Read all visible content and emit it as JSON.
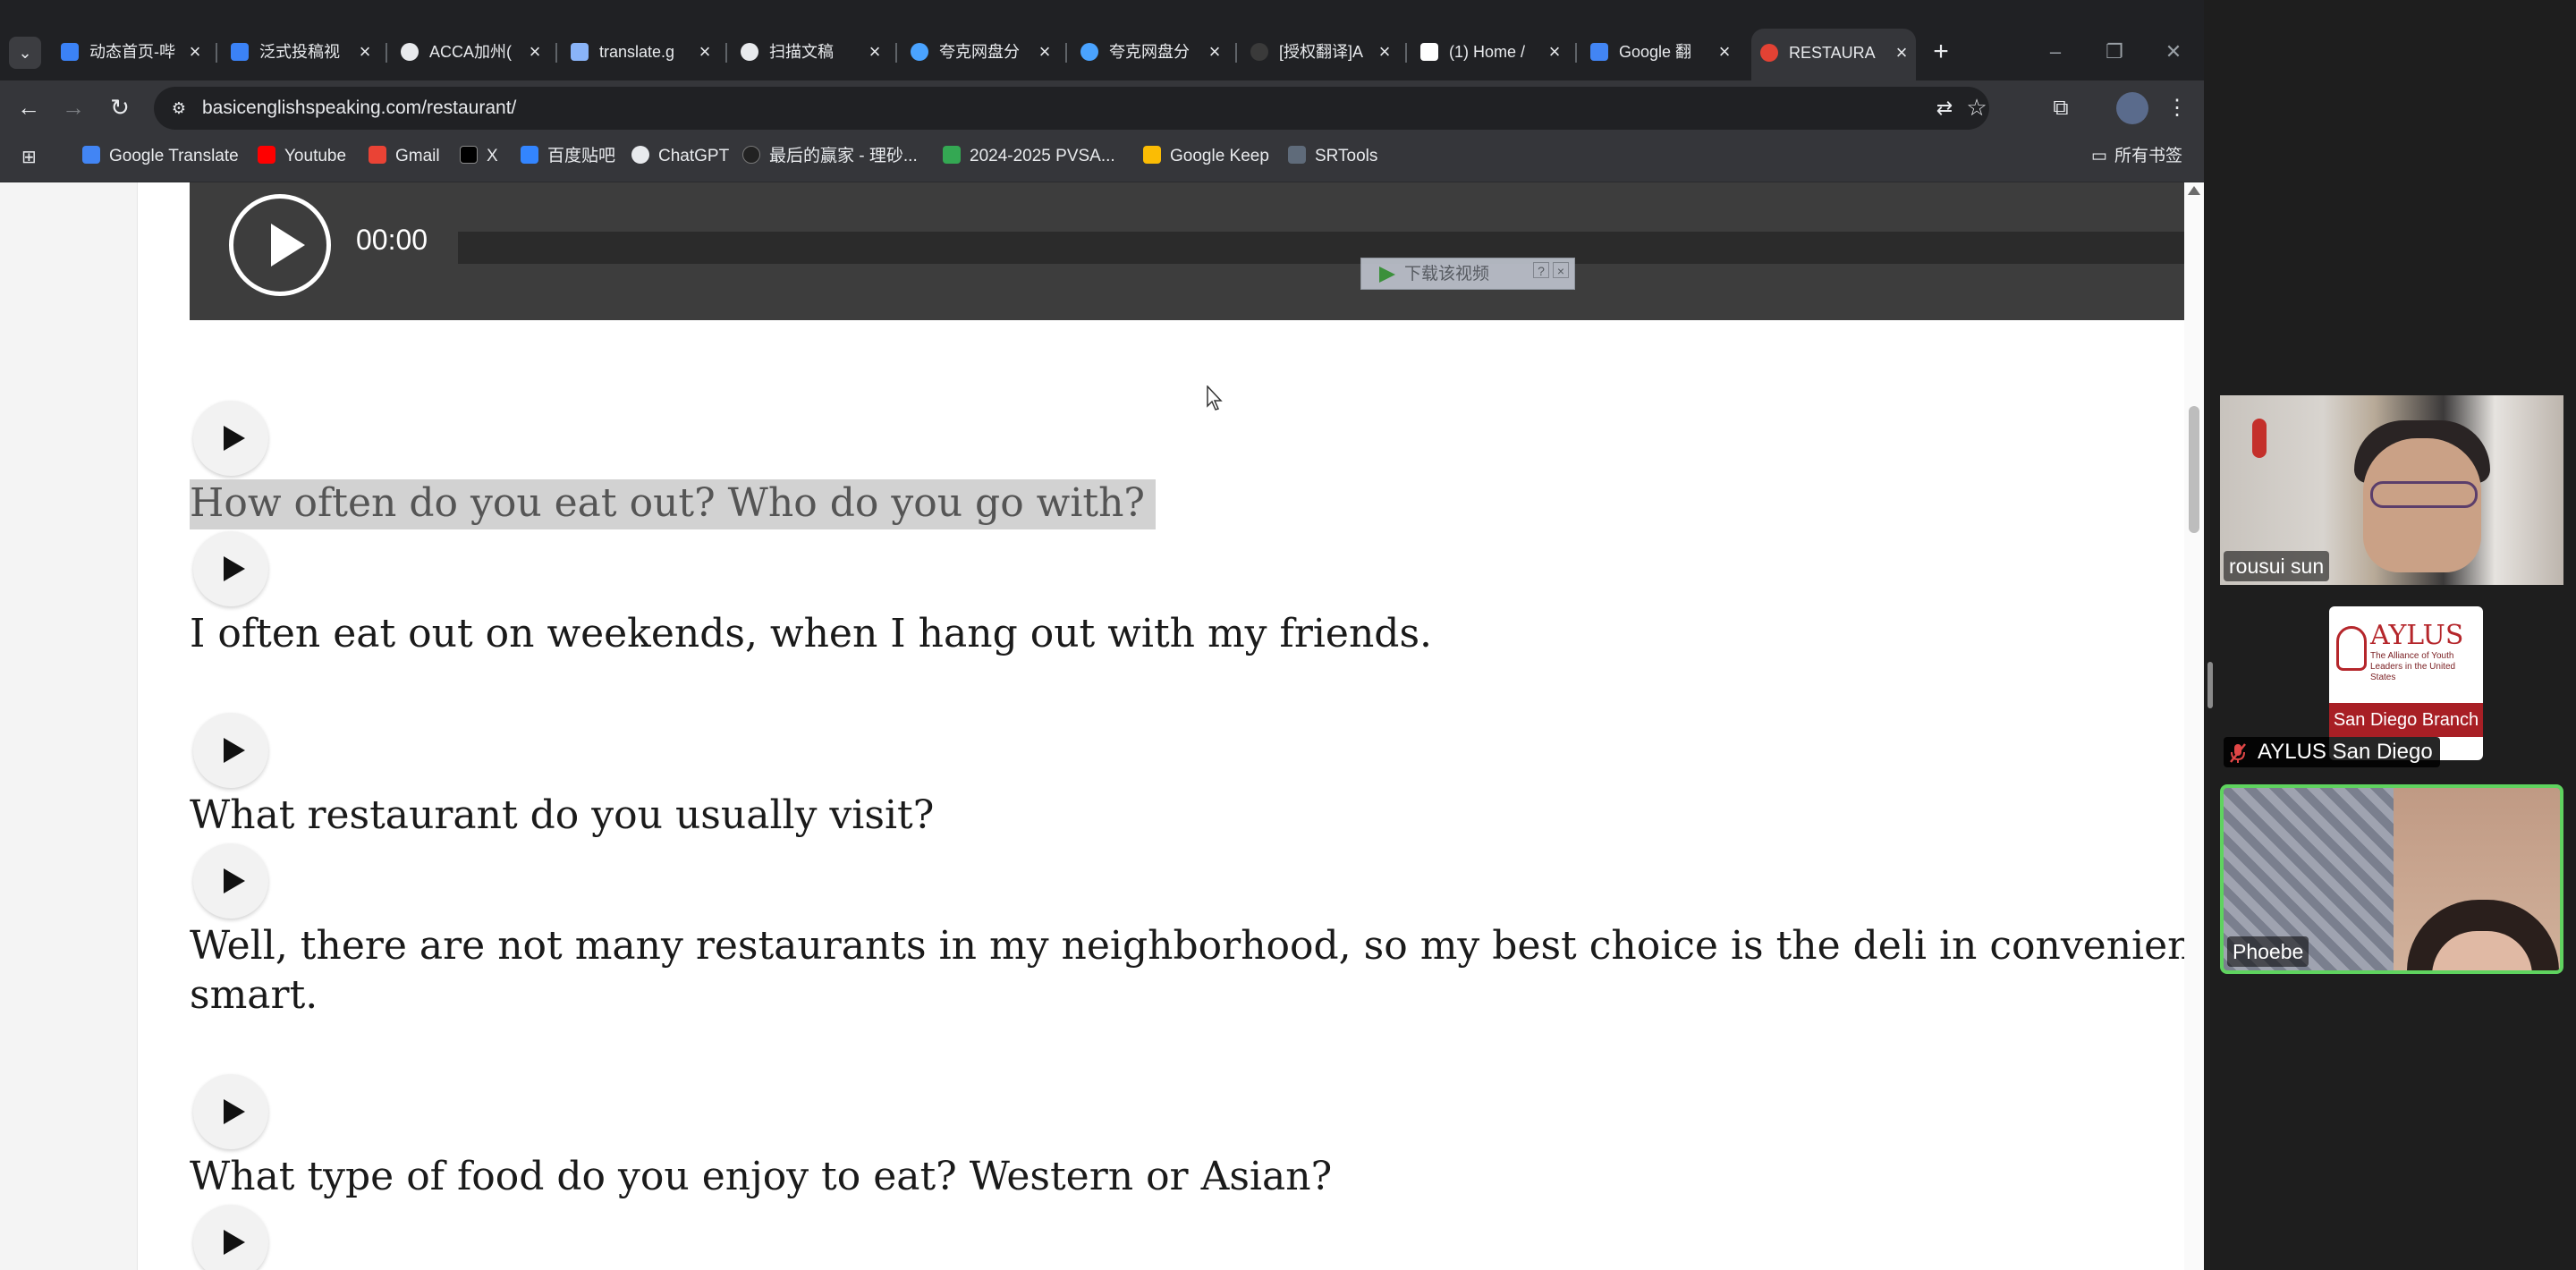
{
  "browser": {
    "tabs": [
      {
        "title": "动态首页-哔",
        "icon_color": "#3b82f6",
        "icon": "bilibili-icon"
      },
      {
        "title": "泛式投稿视",
        "icon_color": "#3b82f6",
        "icon": "bilibili-icon"
      },
      {
        "title": "ACCA加州(",
        "icon_color": "#e8eaed",
        "icon": "globe-icon"
      },
      {
        "title": "translate.g",
        "icon_color": "#8ab4f8",
        "icon": "doc-icon"
      },
      {
        "title": "扫描文稿",
        "icon_color": "#e8eaed",
        "icon": "globe-icon"
      },
      {
        "title": "夸克网盘分",
        "icon_color": "#4aa3ff",
        "icon": "quark-icon"
      },
      {
        "title": "夸克网盘分",
        "icon_color": "#4aa3ff",
        "icon": "quark-icon"
      },
      {
        "title": "[授权翻译]A",
        "icon_color": "#3a3a3a",
        "icon": "site-icon"
      },
      {
        "title": "(1) Home /",
        "icon_color": "#ffffff",
        "icon": "x-icon"
      },
      {
        "title": "Google 翻",
        "icon_color": "#4285f4",
        "icon": "google-translate-icon"
      },
      {
        "title": "RESTAURA",
        "icon_color": "#e34234",
        "icon": "site-icon"
      }
    ],
    "tab_close_glyph": "×",
    "new_tab_glyph": "+",
    "window_controls": {
      "minimize": "–",
      "restore": "❐",
      "close": "✕"
    },
    "nav": {
      "back": "←",
      "forward": "→",
      "reload": "↻"
    },
    "address": {
      "url": "basicenglishspeaking.com/restaurant/",
      "site_info_glyph": "⚙"
    },
    "toolbar_icons": {
      "translate": "⇄",
      "star": "☆",
      "extensions": "⧉",
      "menu": "⋮"
    },
    "bookmarks": [
      {
        "label": "Google Translate",
        "icon_color": "#4285f4"
      },
      {
        "label": "Youtube",
        "icon_color": "#ff0000"
      },
      {
        "label": "Gmail",
        "icon_color": "#ea4335"
      },
      {
        "label": "X",
        "icon_color": "#000000"
      },
      {
        "label": "百度贴吧",
        "icon_color": "#3385ff"
      },
      {
        "label": "ChatGPT",
        "icon_color": "#e8eaed"
      },
      {
        "label": "最后的赢家 - 理砂...",
        "icon_color": "#222222"
      },
      {
        "label": "2024-2025 PVSA...",
        "icon_color": "#34a853"
      },
      {
        "label": "Google Keep",
        "icon_color": "#fbbc04"
      },
      {
        "label": "SRTools",
        "icon_color": "#5f6b7a"
      }
    ],
    "apps_glyph": "⊞",
    "all_bookmarks": "所有书签",
    "folder_glyph": "▭"
  },
  "page": {
    "audio": {
      "time": "00:00"
    },
    "download_popup": {
      "text": "下载该视频",
      "help": "?",
      "close": "×"
    },
    "lines": [
      {
        "text": "How often do you eat out? Who do you go with?",
        "highlight": true
      },
      {
        "text": "I often eat out on weekends, when I hang out with my friends."
      },
      {
        "text": "What restaurant do you usually visit?"
      },
      {
        "text": "Well, there are not many restaurants in my neighborhood, so my best choice is the deli in convenient stor",
        "continuation": "smart."
      },
      {
        "text": "What type of food do you enjoy to eat? Western or Asian?"
      }
    ]
  },
  "meeting": {
    "participants": [
      {
        "name": "rousui sun"
      },
      {
        "name": "AYLUS San Diego",
        "muted": true,
        "logo_title": "AYLUS",
        "logo_tagline": "The Alliance of Youth Leaders in the United States",
        "logo_band": "San Diego Branch"
      },
      {
        "name": "Phoebe",
        "active_speaker": true
      }
    ],
    "active_speaker_color": "#5fd35f",
    "mute_glyph": "🎤"
  }
}
